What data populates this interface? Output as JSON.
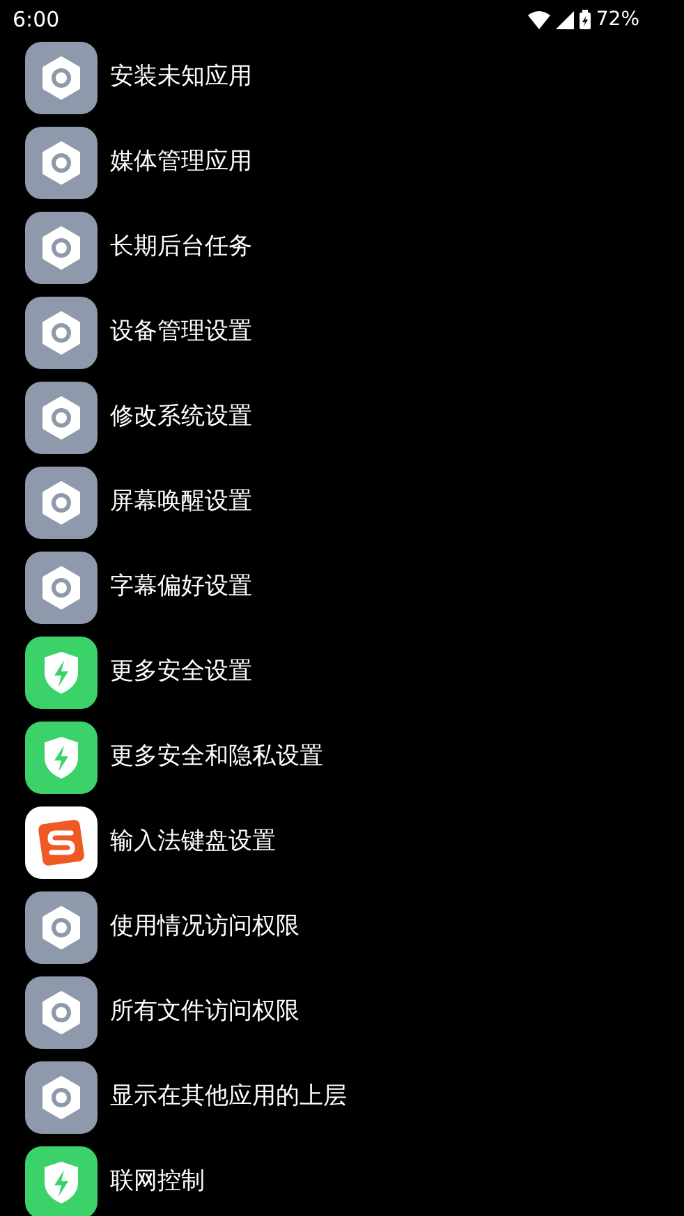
{
  "status_bar": {
    "time": "6:00",
    "battery": "72%"
  },
  "items": [
    {
      "label": "安装未知应用",
      "kind": "settings"
    },
    {
      "label": "媒体管理应用",
      "kind": "settings"
    },
    {
      "label": "长期后台任务",
      "kind": "settings"
    },
    {
      "label": "设备管理设置",
      "kind": "settings"
    },
    {
      "label": "修改系统设置",
      "kind": "settings"
    },
    {
      "label": "屏幕唤醒设置",
      "kind": "settings"
    },
    {
      "label": "字幕偏好设置",
      "kind": "settings"
    },
    {
      "label": "更多安全设置",
      "kind": "security"
    },
    {
      "label": "更多安全和隐私设置",
      "kind": "security"
    },
    {
      "label": "输入法键盘设置",
      "kind": "keyboard"
    },
    {
      "label": "使用情况访问权限",
      "kind": "settings"
    },
    {
      "label": "所有文件访问权限",
      "kind": "settings"
    },
    {
      "label": "显示在其他应用的上层",
      "kind": "settings"
    },
    {
      "label": "联网控制",
      "kind": "security"
    }
  ]
}
